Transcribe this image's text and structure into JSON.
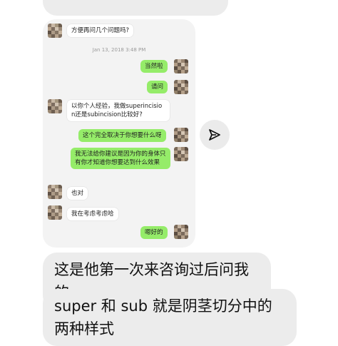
{
  "embedded_chat": {
    "messages": [
      {
        "side": "left",
        "text": "方便再问几个问题吗?"
      },
      {
        "side": "right",
        "text": "当然啦"
      },
      {
        "side": "right",
        "text": "请问"
      },
      {
        "side": "left",
        "text": "以你个人经验，我做superincision还是subincision比较好?"
      },
      {
        "side": "right",
        "text": "这个完全取决于你想要什么呀"
      },
      {
        "side": "right",
        "text": "我无法给你建议是因为你的身体只有你才知道你想要达到什么效果"
      },
      {
        "side": "left",
        "text": "也对"
      },
      {
        "side": "left",
        "text": "我在考虑考虑哈"
      },
      {
        "side": "right",
        "text": "嗯好的"
      }
    ],
    "timestamp": "Jan 13, 2018 3:48 PM"
  },
  "outer_messages": [
    {
      "text": "这是他第一次来咨询过后问我的"
    },
    {
      "text": "super 和 sub 就是阴茎切分中的两种样式"
    }
  ],
  "icons": {
    "share": "send-arrow-icon",
    "avatar_left": "pixelated-avatar-icon",
    "avatar_right": "pixelated-avatar-icon"
  },
  "colors": {
    "green_bubble": "#95ec69",
    "gray_bubble": "#ececec",
    "panel_bg": "#f3f3f3"
  }
}
